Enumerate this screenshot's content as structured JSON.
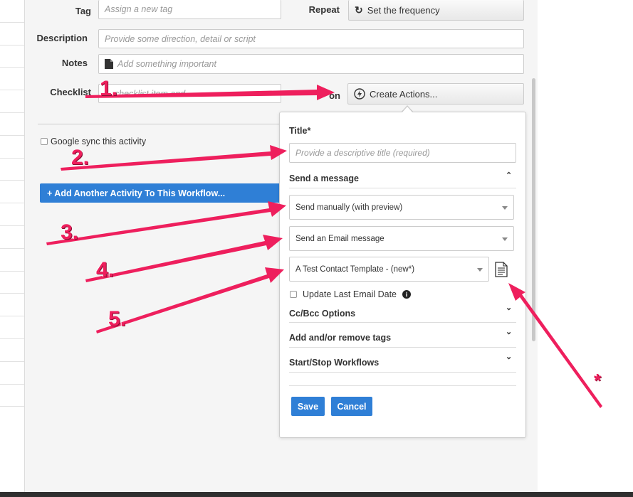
{
  "form": {
    "tag_label": "Tag",
    "tag_placeholder": "Assign a new tag",
    "repeat_label": "Repeat",
    "repeat_button": "Set the frequency",
    "description_label": "Description",
    "description_placeholder": "Provide some direction, detail or script",
    "notes_label": "Notes",
    "notes_placeholder": "Add something important",
    "checklist_label": "Checklist",
    "checklist_placeholder": "... checklist item and ...",
    "action_label_partial": "on",
    "create_actions_button": "Create Actions...",
    "google_sync_label": "Google sync this activity",
    "add_activity_button": "+ Add Another Activity To This Workflow..."
  },
  "popover": {
    "title_label": "Title*",
    "title_placeholder": "Provide a descriptive title (required)",
    "send_message_header": "Send a message",
    "send_mode_value": "Send manually (with preview)",
    "message_type_value": "Send an Email message",
    "template_value": "A Test Contact Template - (new*)",
    "update_last_email_label": "Update Last Email Date",
    "cc_bcc_header": "Cc/Bcc Options",
    "tags_header": "Add and/or remove tags",
    "workflows_header": "Start/Stop Workflows",
    "save_button": "Save",
    "cancel_button": "Cancel"
  },
  "annotations": {
    "label_1": "1.",
    "label_2": "2.",
    "label_3": "3.",
    "label_4": "4.",
    "label_5": "5.",
    "label_star": "*",
    "color": "#ee1f5d"
  },
  "colors": {
    "accent_blue": "#2f7fd6",
    "panel_bg": "#f5f5f5"
  }
}
